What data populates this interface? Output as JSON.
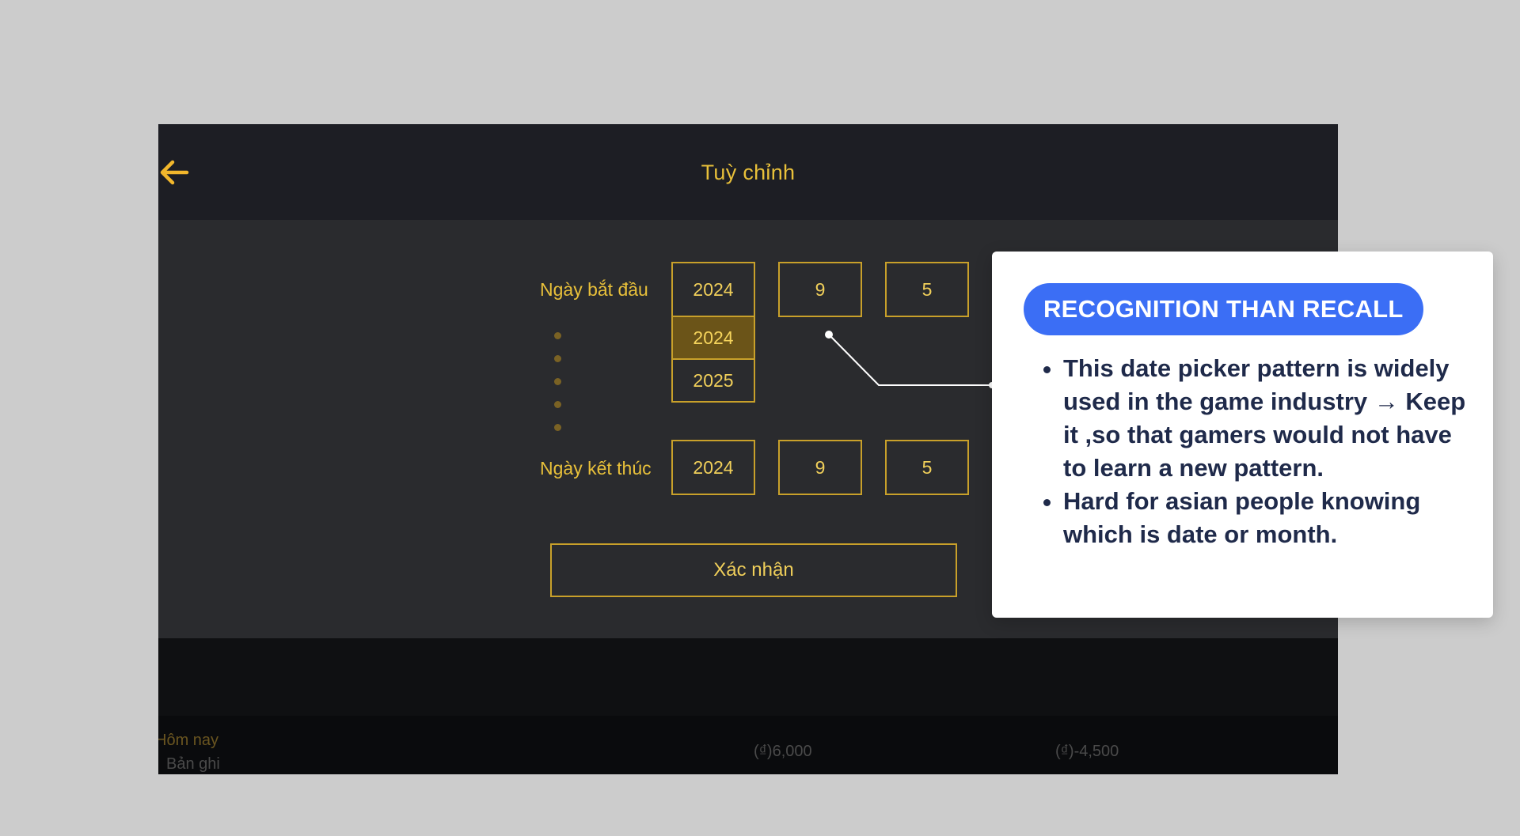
{
  "header": {
    "title": "Tuỳ chỉnh",
    "back_icon": "arrow-left-icon"
  },
  "form": {
    "start_label": "Ngày bắt đầu",
    "end_label": "Ngày kết thúc",
    "start": {
      "year": "2024",
      "month": "9",
      "day": "5"
    },
    "end": {
      "year": "2024",
      "month": "9",
      "day": "5"
    },
    "year_options": [
      "2024",
      "2025"
    ],
    "selected_year": "2024",
    "confirm_label": "Xác nhận"
  },
  "background_list": {
    "today_label": "Hôm nay",
    "record_label": "Bản ghi",
    "amount_1": "(₫)6,000",
    "amount_2": "(₫)-4,500"
  },
  "callout": {
    "badge": "RECOGNITION THAN RECALL",
    "points": [
      "This date picker pattern is widely used in the game industry → Keep it ,so that gamers would not have to learn a new pattern.",
      "Hard for asian people knowing which is date or month."
    ]
  },
  "colors": {
    "accent_gold": "#e8c03a",
    "badge_blue": "#3b6ef5",
    "callout_text": "#1f2a4a"
  }
}
